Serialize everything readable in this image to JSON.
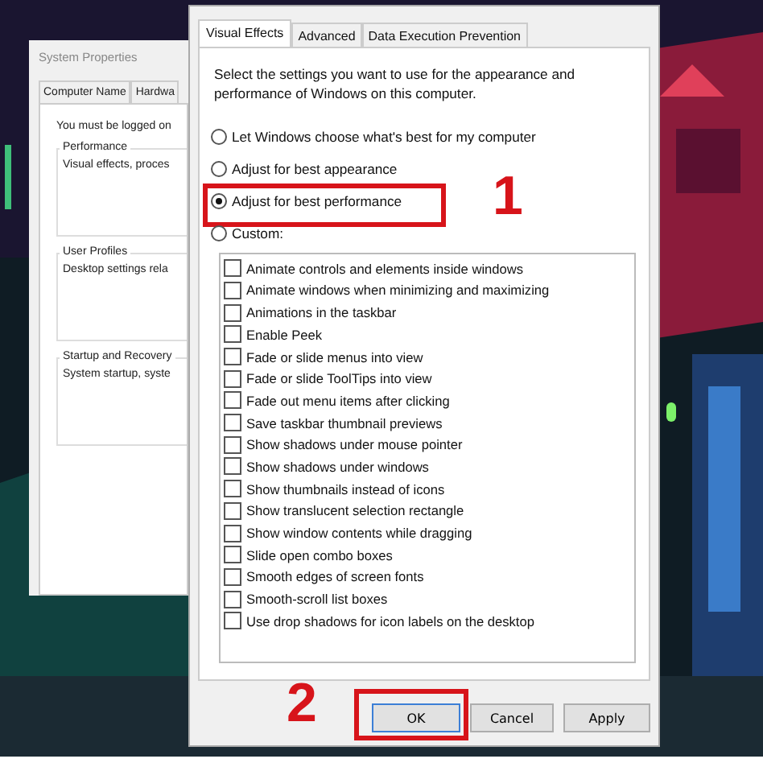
{
  "background_window": {
    "title": "System Properties",
    "tabs": [
      {
        "label": "Computer Name",
        "selected": false
      },
      {
        "label": "Hardwa",
        "selected": false
      }
    ],
    "notice": "You must be logged on",
    "groups": [
      {
        "title": "Performance",
        "text": "Visual effects, proces"
      },
      {
        "title": "User Profiles",
        "text": "Desktop settings rela"
      },
      {
        "title": "Startup and Recovery",
        "text": "System startup, syste"
      }
    ]
  },
  "dialog": {
    "tabs": [
      {
        "label": "Visual Effects",
        "selected": true
      },
      {
        "label": "Advanced",
        "selected": false
      },
      {
        "label": "Data Execution Prevention",
        "selected": false
      }
    ],
    "description": "Select the settings you want to use for the appearance and performance of Windows on this computer.",
    "options": [
      {
        "label": "Let Windows choose what's best for my computer",
        "selected": false
      },
      {
        "label": "Adjust for best appearance",
        "selected": false
      },
      {
        "label": "Adjust for best performance",
        "selected": true,
        "highlighted": true
      },
      {
        "label": "Custom:",
        "selected": false
      }
    ],
    "effects": [
      {
        "label": "Animate controls and elements inside windows",
        "checked": false
      },
      {
        "label": "Animate windows when minimizing and maximizing",
        "checked": false
      },
      {
        "label": "Animations in the taskbar",
        "checked": false
      },
      {
        "label": "Enable Peek",
        "checked": false
      },
      {
        "label": "Fade or slide menus into view",
        "checked": false
      },
      {
        "label": "Fade or slide ToolTips into view",
        "checked": false
      },
      {
        "label": "Fade out menu items after clicking",
        "checked": false
      },
      {
        "label": "Save taskbar thumbnail previews",
        "checked": false
      },
      {
        "label": "Show shadows under mouse pointer",
        "checked": false
      },
      {
        "label": "Show shadows under windows",
        "checked": false
      },
      {
        "label": "Show thumbnails instead of icons",
        "checked": false
      },
      {
        "label": "Show translucent selection rectangle",
        "checked": false
      },
      {
        "label": "Show window contents while dragging",
        "checked": false
      },
      {
        "label": "Slide open combo boxes",
        "checked": false
      },
      {
        "label": "Smooth edges of screen fonts",
        "checked": false
      },
      {
        "label": "Smooth-scroll list boxes",
        "checked": false
      },
      {
        "label": "Use drop shadows for icon labels on the desktop",
        "checked": false
      }
    ],
    "buttons": [
      {
        "label": "OK",
        "highlighted": true
      },
      {
        "label": "Cancel",
        "highlighted": false
      },
      {
        "label": "Apply",
        "highlighted": false
      }
    ]
  },
  "annotations": [
    {
      "label": "1"
    },
    {
      "label": "2"
    }
  ]
}
